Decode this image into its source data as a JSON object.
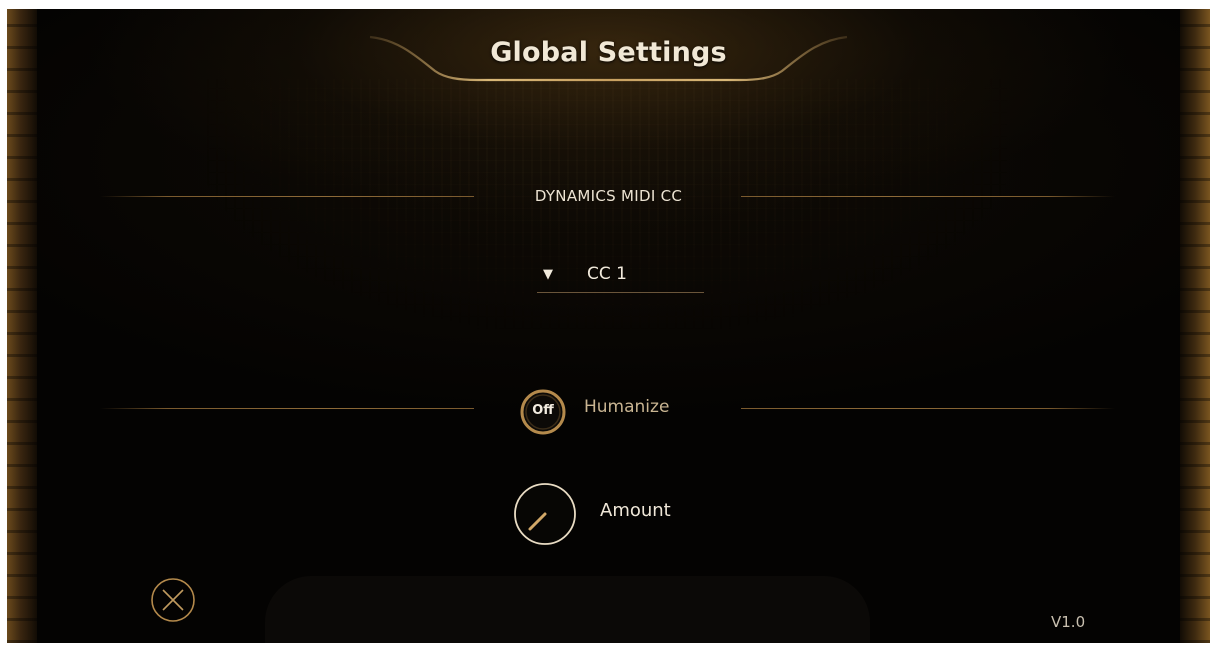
{
  "window": {
    "title": "Global Settings"
  },
  "dynamics": {
    "section_label": "DYNAMICS MIDI CC",
    "selected_cc": "CC 1"
  },
  "humanize": {
    "toggle_state": "Off",
    "label": "Humanize"
  },
  "amount": {
    "label": "Amount"
  },
  "footer": {
    "version": "V1.0"
  },
  "icons": {
    "dropdown": "triangle-down-icon",
    "close": "close-x-icon"
  },
  "colors": {
    "background": "#040302",
    "accent_gold": "#c8a060",
    "text_light": "#f1e8d6",
    "text_muted": "#c9b592"
  }
}
